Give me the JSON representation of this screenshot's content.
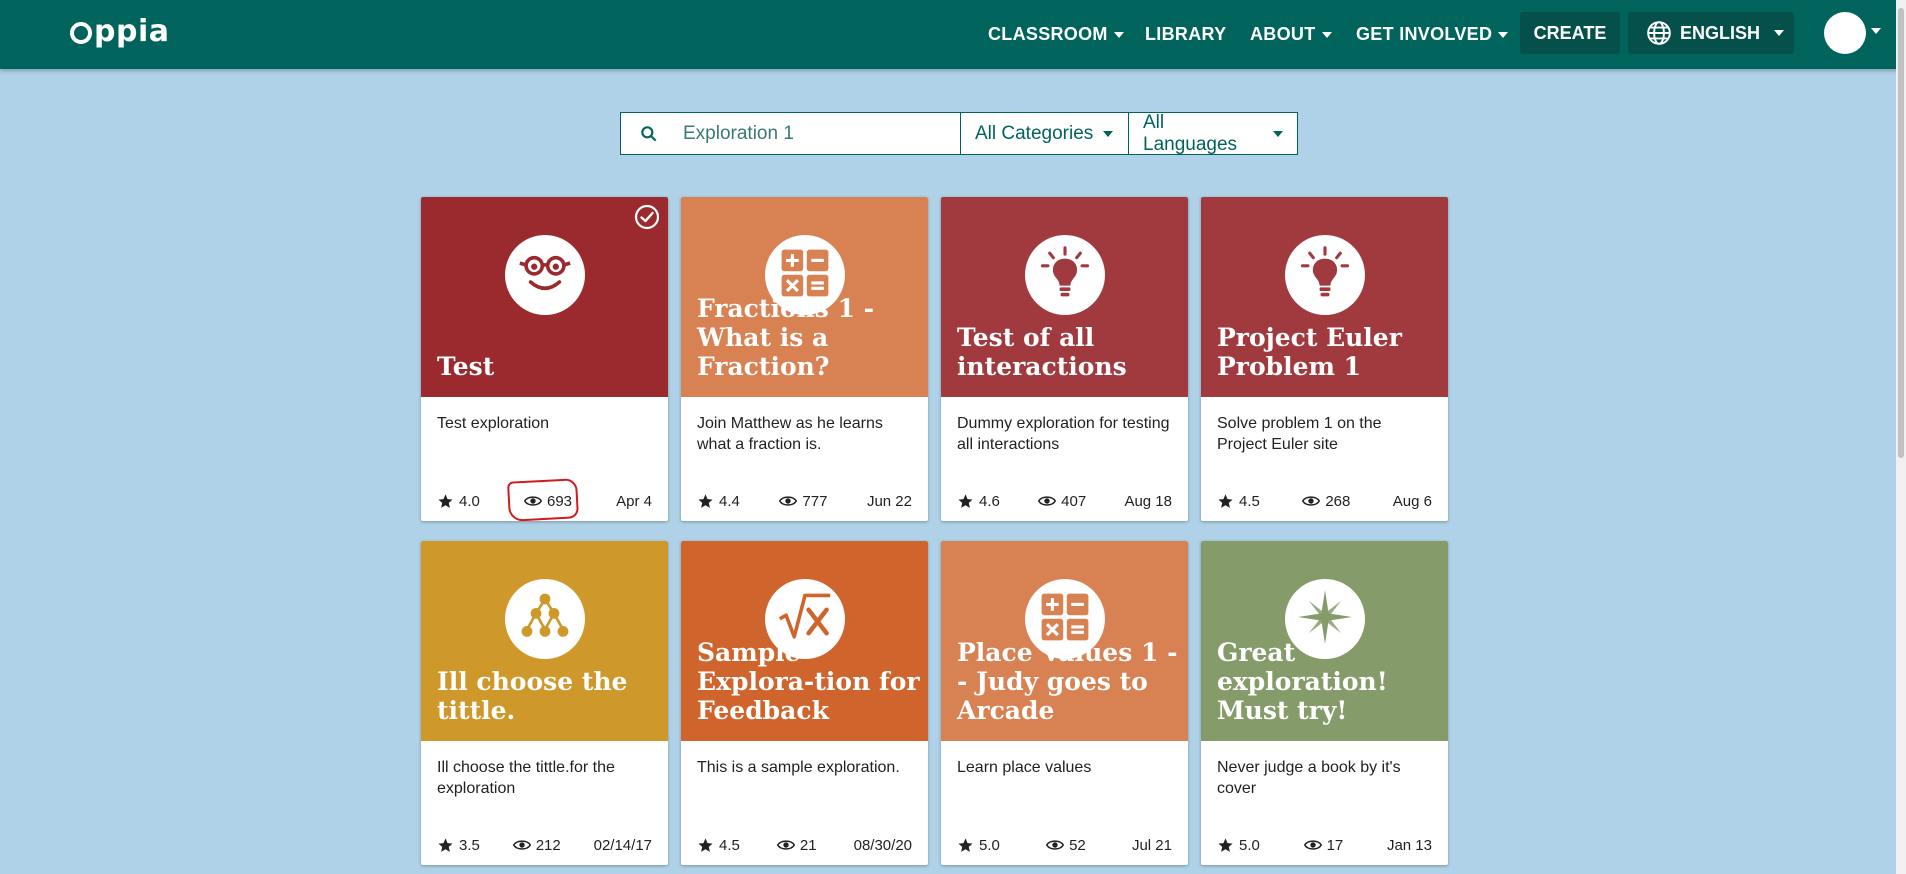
{
  "header": {
    "logo_text": "ppia",
    "nav": [
      {
        "label": "CLASSROOM",
        "dropdown": true
      },
      {
        "label": "LIBRARY",
        "dropdown": false
      },
      {
        "label": "ABOUT",
        "dropdown": true
      },
      {
        "label": "GET INVOLVED",
        "dropdown": true
      }
    ],
    "create_label": "CREATE",
    "language_label": "ENGLISH"
  },
  "search": {
    "value": "Exploration 1",
    "category": "All Categories",
    "language": "All Languages"
  },
  "cards": [
    {
      "title": "Test",
      "description": "Test exploration",
      "rating": "4.0",
      "views": "693",
      "date": "Apr 4",
      "color": "#9a2a2e",
      "icon": "smiley-glasses-icon",
      "completed": true
    },
    {
      "title": "Fractions 1 - What is a Fraction?",
      "description": "Join Matthew as he learns what a fraction is.",
      "rating": "4.4",
      "views": "777",
      "date": "Jun 22",
      "color": "#d88152",
      "icon": "calculator-icon",
      "completed": false
    },
    {
      "title": "Test of all interactions",
      "description": "Dummy exploration for testing all interactions",
      "rating": "4.6",
      "views": "407",
      "date": "Aug 18",
      "color": "#a13a3f",
      "icon": "lightbulb-icon",
      "completed": false
    },
    {
      "title": "Project Euler Problem 1",
      "description": "Solve problem 1 on the Project Euler site",
      "rating": "4.5",
      "views": "268",
      "date": "Aug 6",
      "color": "#a13a3f",
      "icon": "lightbulb-icon",
      "completed": false
    },
    {
      "title": "Ill choose the tittle.",
      "description": "Ill choose the tittle.for the exploration",
      "rating": "3.5",
      "views": "212",
      "date": "02/14/17",
      "color": "#cf982b",
      "icon": "tree-diagram-icon",
      "completed": false
    },
    {
      "title": "Sample Explora-tion for Feedback",
      "description": "This is a sample exploration.",
      "rating": "4.5",
      "views": "21",
      "date": "08/30/20",
      "color": "#cf642d",
      "icon": "square-root-icon",
      "completed": false
    },
    {
      "title": "Place Values 1 -- Judy goes to Arcade",
      "description": "Learn place values",
      "rating": "5.0",
      "views": "52",
      "date": "Jul 21",
      "color": "#d88152",
      "icon": "calculator-icon",
      "completed": false
    },
    {
      "title": "Great exploration! Must try!",
      "description": "Never judge a book by it's cover",
      "rating": "5.0",
      "views": "17",
      "date": "Jan 13",
      "color": "#859c6a",
      "icon": "compass-star-icon",
      "completed": false
    }
  ]
}
